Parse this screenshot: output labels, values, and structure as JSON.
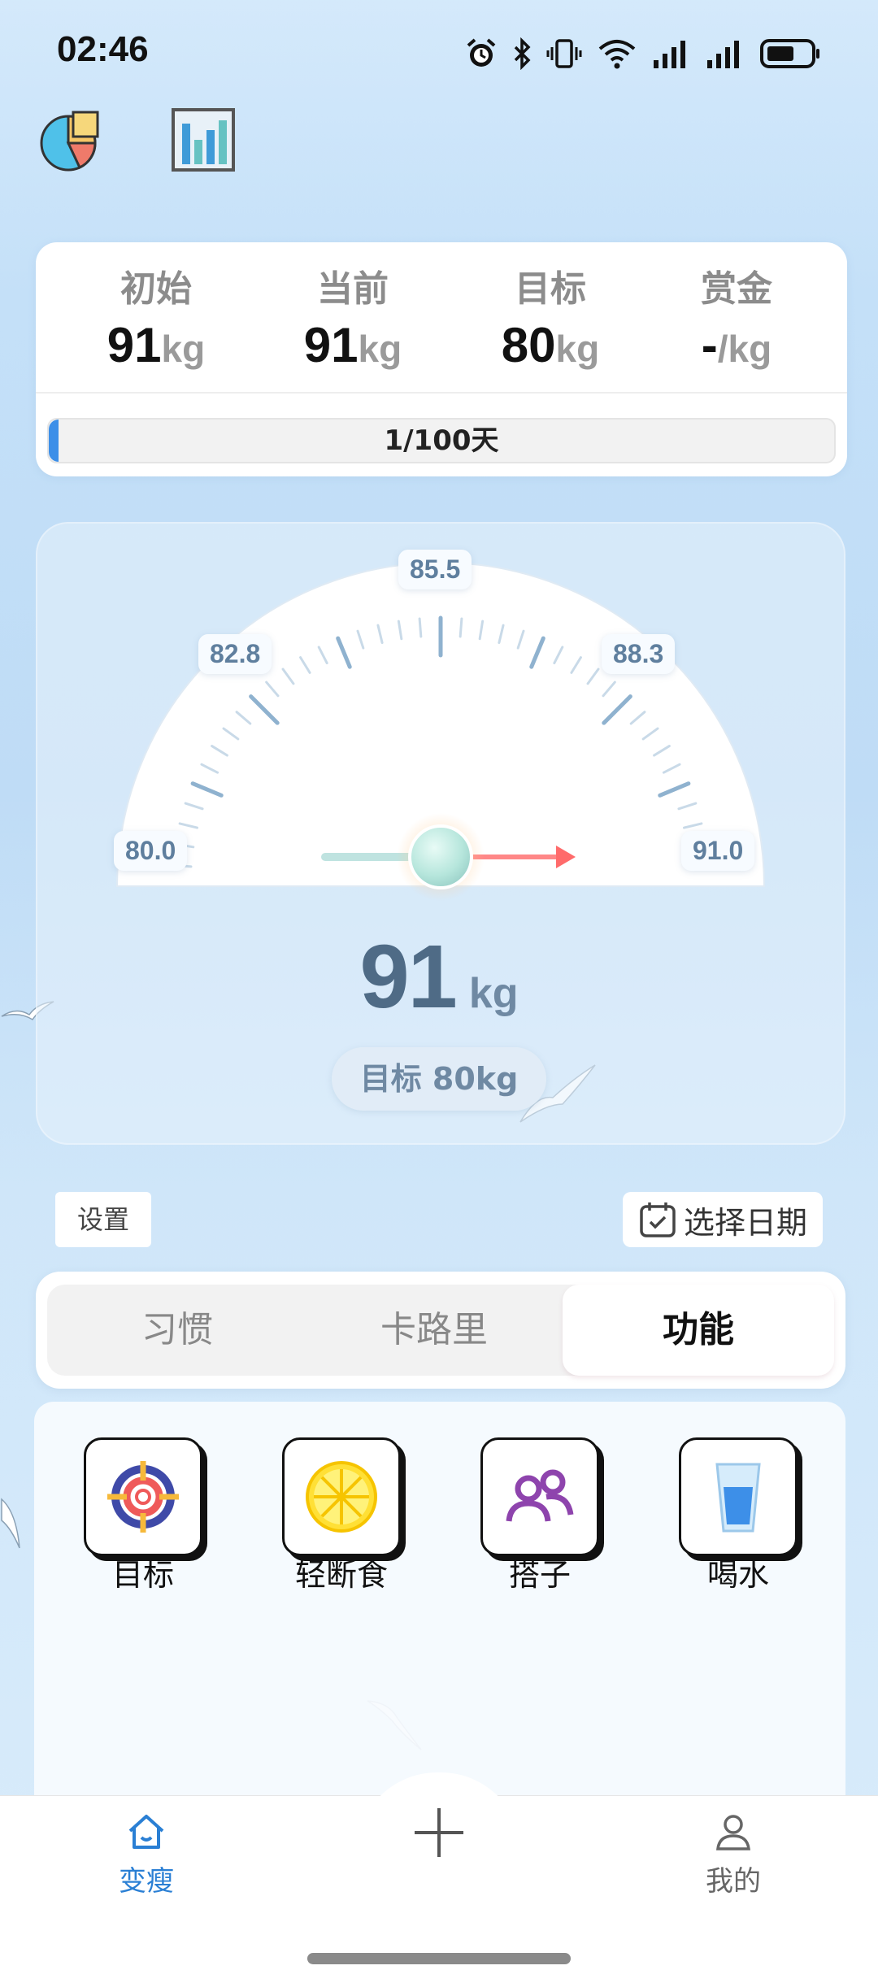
{
  "status_bar": {
    "time": "02:46"
  },
  "summary": {
    "stats": [
      {
        "label": "初始",
        "value": "91",
        "unit": "kg"
      },
      {
        "label": "当前",
        "value": "91",
        "unit": "kg"
      },
      {
        "label": "目标",
        "value": "80",
        "unit": "kg"
      },
      {
        "label": "赏金",
        "value": "-",
        "unit": "/kg"
      }
    ],
    "progress_text": "1/100天",
    "progress_fraction": 0.01
  },
  "gauge": {
    "min_label": "80.0",
    "max_label": "91.0",
    "tick_labels": [
      "82.8",
      "85.5",
      "88.3"
    ],
    "current_value": "91",
    "unit": "kg",
    "target_text": "目标 80kg",
    "accent_color": "#ff6b6b"
  },
  "controls": {
    "settings_label": "设置",
    "date_label": "选择日期"
  },
  "tabs": [
    {
      "label": "习惯",
      "active": false
    },
    {
      "label": "卡路里",
      "active": false
    },
    {
      "label": "功能",
      "active": true
    }
  ],
  "features": [
    {
      "label": "目标",
      "icon": "target-icon"
    },
    {
      "label": "轻断食",
      "icon": "lemon-icon"
    },
    {
      "label": "搭子",
      "icon": "buddies-icon"
    },
    {
      "label": "喝水",
      "icon": "water-glass-icon"
    }
  ],
  "bottom_nav": {
    "items": [
      {
        "label": "变瘦",
        "icon": "home-icon",
        "active": true
      },
      {
        "label": "我的",
        "icon": "profile-icon",
        "active": false
      }
    ],
    "add_icon": "plus-icon",
    "active_color": "#2a7fd4"
  }
}
